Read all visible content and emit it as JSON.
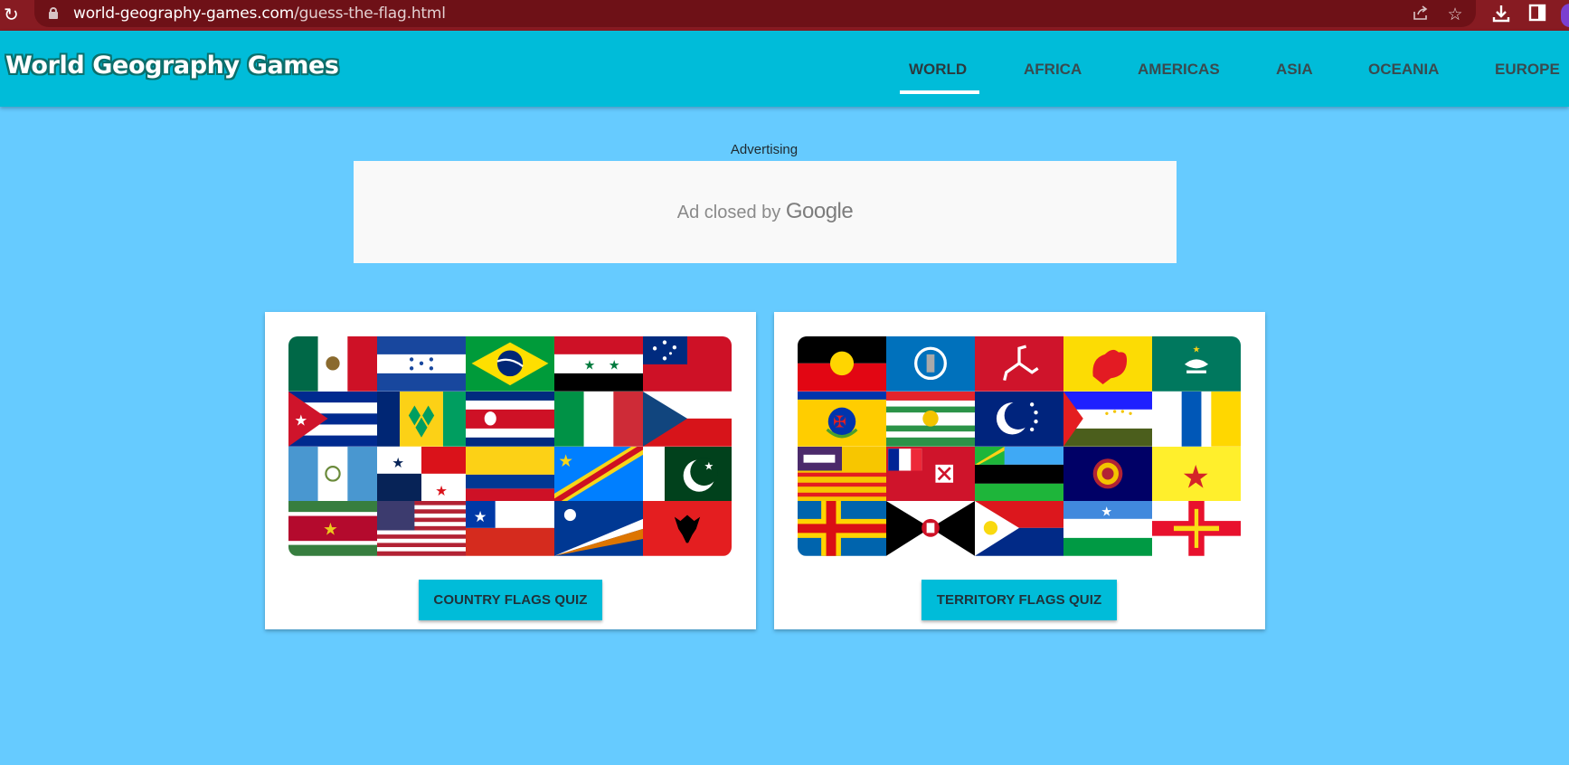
{
  "browser": {
    "url_host": "world-geography-games.com",
    "url_path": "/guess-the-flag.html",
    "icons": [
      "reload-icon",
      "lock-icon",
      "share-icon",
      "star-icon",
      "download-icon",
      "sidebar-icon",
      "profile-avatar"
    ]
  },
  "header": {
    "logo": "World Geography Games",
    "nav": [
      {
        "label": "WORLD",
        "active": true
      },
      {
        "label": "AFRICA",
        "active": false
      },
      {
        "label": "AMERICAS",
        "active": false
      },
      {
        "label": "ASIA",
        "active": false
      },
      {
        "label": "OCEANIA",
        "active": false
      },
      {
        "label": "EUROPE",
        "active": false
      }
    ]
  },
  "ad": {
    "label": "Advertising",
    "closed_text": "Ad closed by",
    "brand": "Google"
  },
  "cards": [
    {
      "button": "COUNTRY FLAGS QUIZ",
      "flags": [
        "mexico",
        "honduras",
        "brazil",
        "syria",
        "samoa",
        "cuba",
        "saint-vincent",
        "costa-rica",
        "italy",
        "czechia",
        "guatemala",
        "panama",
        "colombia",
        "dr-congo",
        "pakistan",
        "suriname",
        "usa",
        "chile",
        "marshall-islands",
        "albania"
      ]
    },
    {
      "button": "TERRITORY FLAGS QUIZ",
      "flags": [
        "aboriginal",
        "northern-mariana",
        "isle-of-man",
        "wallonia",
        "macau",
        "kanaky",
        "chittagong",
        "ryukyu",
        "tajik",
        "ukrainian-like",
        "cordillera",
        "wallis-futuna",
        "zanzibar",
        "palau-seal",
        "guangxi",
        "aland",
        "timor-coat",
        "sint-maarten",
        "somaliland",
        "guernsey"
      ]
    }
  ],
  "colors": {
    "page_bg": "#66cbff",
    "header_bg": "#00bcd9",
    "browser_bar": "#871b22",
    "button_bg": "#00bcd9"
  }
}
